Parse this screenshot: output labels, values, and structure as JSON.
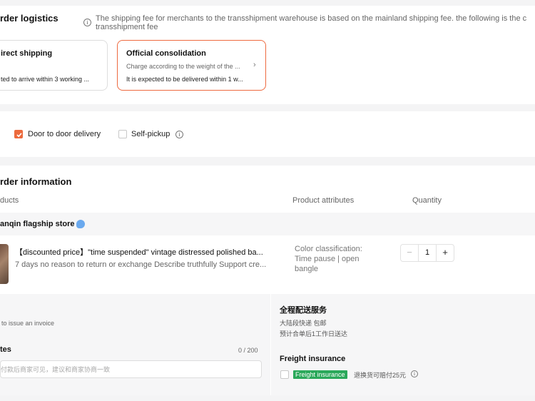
{
  "logistics": {
    "title": "rder logistics",
    "note": "The shipping fee for merchants to the transshipment warehouse is based on the mainland shipping fee. the following is the c",
    "note_line2": "transshipment fee",
    "cards": [
      {
        "title": "irect shipping",
        "detail": "ted to arrive within 3 working ..."
      },
      {
        "title": "Official consolidation",
        "sub": "Charge according to the weight of the ...",
        "detail": "It is expected to be delivered within 1 w..."
      }
    ]
  },
  "delivery": {
    "door": "Door to door delivery",
    "pickup": "Self-pickup"
  },
  "order": {
    "title": "rder information",
    "col_products": "ducts",
    "col_attributes": "Product attributes",
    "col_quantity": "Quantity",
    "store_name": "anqin flagship store",
    "product": {
      "title": "【discounted price】\"time suspended\" vintage distressed polished ba...",
      "tags": "7 days no reason to return or exchange  Describe truthfully  Support cre...",
      "attr_label": "Color classification:",
      "attr_value_1": "Time pause | open",
      "attr_value_2": "bangle",
      "quantity": "1",
      "minus": "−",
      "plus": "+"
    },
    "invoice": "to issue an invoice",
    "notes_label": "tes",
    "notes_count": "0 / 200",
    "notes_placeholder": "付款后商家可见，建议和商家协商一致",
    "service": {
      "title": "全程配送服务",
      "line1": "大陆段快递 包邮",
      "line2": "预计合单后1工作日送达"
    },
    "freight": {
      "title": "Freight insurance",
      "tag": "Freight insurance",
      "desc": "退换货可赔付25元"
    }
  },
  "colors": {
    "accent": "#ec6a3d",
    "green": "#2aa85a"
  },
  "icons": [
    "info-icon",
    "chevron-right-icon",
    "checkbox-checked-icon",
    "store-badge-icon"
  ]
}
